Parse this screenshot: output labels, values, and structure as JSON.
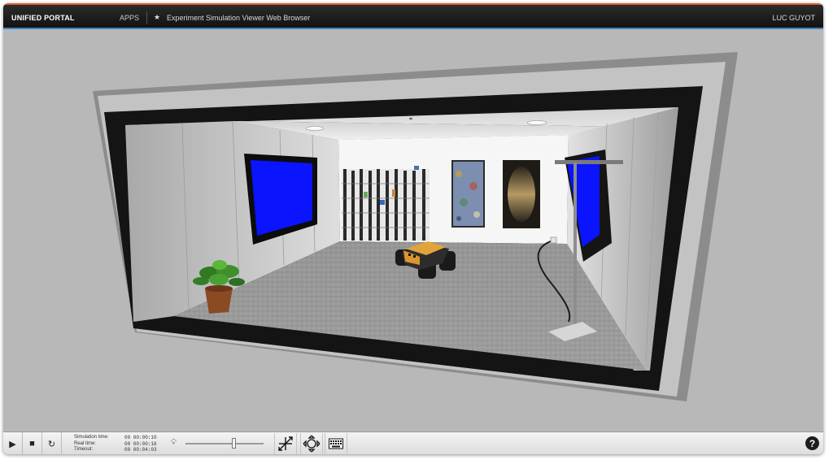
{
  "topbar": {
    "brand": "UNIFIED PORTAL",
    "apps": "APPS",
    "star_icon": "star-icon",
    "breadcrumb": "Experiment Simulation Viewer Web Browser",
    "user": "LUC GUYOT",
    "accent_top": "#d9622b",
    "accent_bottom": "#3f86c2"
  },
  "controls": {
    "play_icon": "play-icon",
    "stop_icon": "stop-icon",
    "reset_icon": "reset-icon",
    "stats": [
      {
        "label": "Simulation time:",
        "value": "00 00:00:10"
      },
      {
        "label": "Real time:",
        "value": "00 00:00:16"
      },
      {
        "label": "Timeout:",
        "value": "00 00:04:03"
      }
    ],
    "light_icon": "lightbulb-icon",
    "light_level": 0.63,
    "tools": [
      "move-camera-icon",
      "rotate-camera-icon",
      "keyboard-icon"
    ],
    "help_label": "?"
  }
}
